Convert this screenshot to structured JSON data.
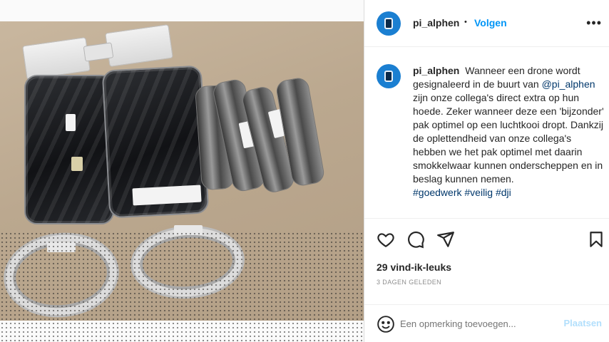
{
  "post": {
    "username": "pi_alphen",
    "follow_label": "Volgen",
    "separator": "•",
    "more_label": "•••",
    "caption_intro": "Wanneer een drone wordt gesignaleerd in de buurt van",
    "caption_mention": "@pi_alphen",
    "caption_body": "zijn onze collega's direct extra op hun hoede. Zeker wanneer deze een 'bijzonder' pak optimel op een luchtkooi dropt. Dankzij de oplettendheid van onze collega's hebben we het pak optimel met daarin smokkelwaar kunnen onderscheppen en in beslag kunnen nemen.",
    "hashtags": [
      "#goedwerk",
      "#veilig",
      "#dji"
    ],
    "likes_label": "29 vind-ik-leuks",
    "time_label": "3 DAGEN GELEDEN",
    "comment_placeholder": "Een opmerking toevoegen...",
    "post_label": "Plaatsen"
  },
  "icons": {
    "like": "heart-icon",
    "comment": "comment-icon",
    "share": "share-icon",
    "save": "bookmark-icon",
    "emoji": "emoji-icon",
    "more": "more-icon"
  },
  "colors": {
    "link": "#0095f6",
    "hashtag": "#00376b",
    "avatar": "#1b7fd1",
    "muted": "#8e8e8e"
  }
}
